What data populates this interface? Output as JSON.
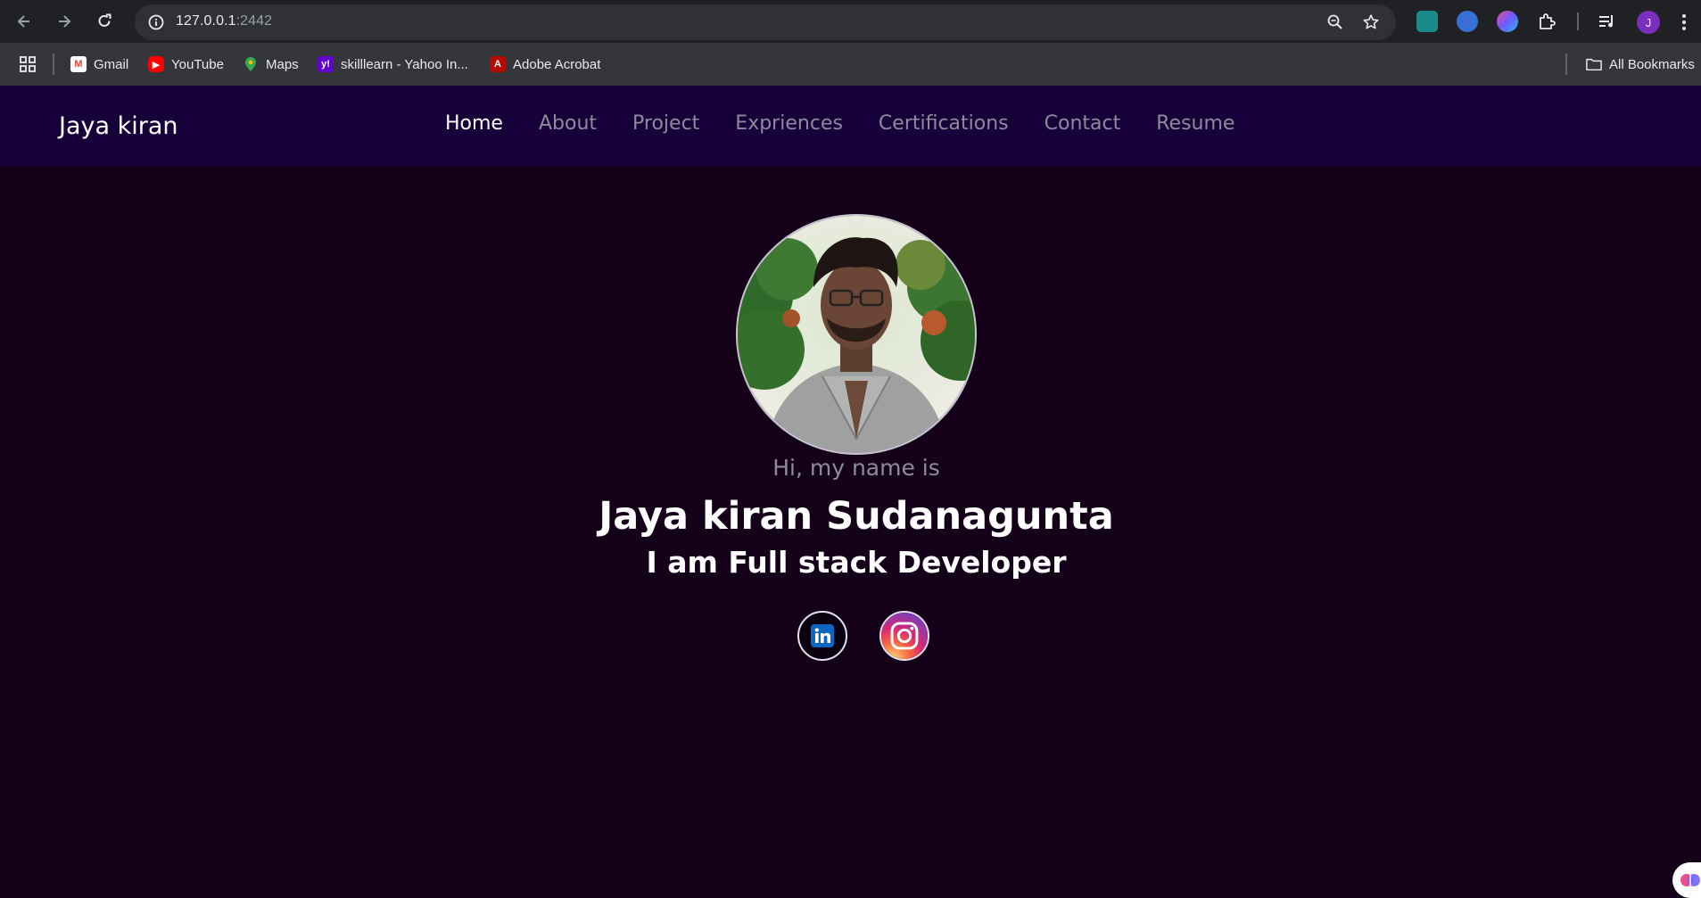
{
  "browser": {
    "url_host": "127.0.0.1",
    "url_port": ":2442",
    "profile_initial": "J",
    "bookmarks": [
      {
        "label": "Gmail",
        "icon": "gmail-icon"
      },
      {
        "label": "YouTube",
        "icon": "youtube-icon"
      },
      {
        "label": "Maps",
        "icon": "maps-icon"
      },
      {
        "label": "skilllearn - Yahoo In...",
        "icon": "yahoo-icon"
      },
      {
        "label": "Adobe Acrobat",
        "icon": "acrobat-icon"
      }
    ],
    "all_bookmarks_label": "All Bookmarks"
  },
  "site": {
    "brand": "Jaya kiran",
    "menu": [
      "Home",
      "About",
      "Project",
      "Expriences",
      "Certifications",
      "Contact",
      "Resume"
    ],
    "active_menu": "Home",
    "greeting": "Hi, my name is",
    "full_name": "Jaya kiran Sudanagunta",
    "role": "I am Full stack Developer",
    "social": [
      {
        "name": "LinkedIn",
        "icon": "linkedin-icon"
      },
      {
        "name": "Instagram",
        "icon": "instagram-icon"
      }
    ]
  },
  "colors": {
    "page_bg": "#140019",
    "nav_bg": "#17003a",
    "menu_inactive": "#8e8a9d",
    "text_primary": "#ffffff"
  }
}
